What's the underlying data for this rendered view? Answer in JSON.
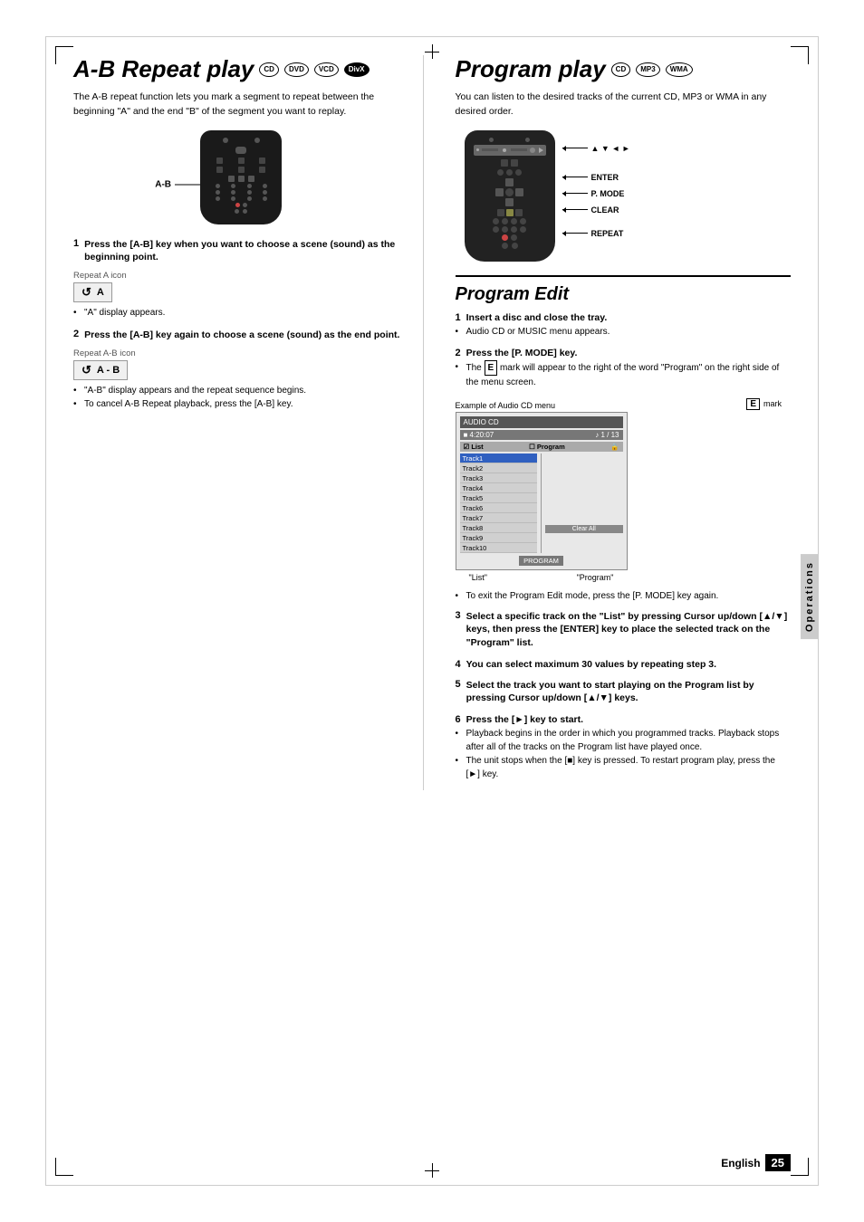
{
  "page": {
    "number": "25",
    "language": "English"
  },
  "ab_repeat": {
    "title": "A-B Repeat play",
    "formats": [
      "CD",
      "DVD",
      "VCD",
      "DivX"
    ],
    "intro": "The A-B repeat function lets you mark a segment to repeat between the beginning \"A\" and the end \"B\" of the segment you want to replay.",
    "ab_label": "A-B",
    "steps": [
      {
        "num": "1",
        "title": "Press the [A-B] key when you want to choose a scene (sound) as the beginning point.",
        "note_label": "Repeat A icon",
        "icon_text": "A",
        "bullets": [
          "\"A\" display appears."
        ]
      },
      {
        "num": "2",
        "title": "Press the [A-B] key again to choose a scene (sound) as the end point.",
        "note_label": "Repeat A-B icon",
        "icon_text": "A - B",
        "bullets": [
          "\"A-B\" display appears and the repeat sequence begins.",
          "To cancel A-B Repeat playback, press the [A-B] key."
        ]
      }
    ]
  },
  "program_play": {
    "title": "Program play",
    "formats": [
      "CD",
      "MP3",
      "WMA"
    ],
    "intro": "You can listen to the desired tracks of the current CD, MP3 or WMA in any desired order.",
    "labels": {
      "nav_arrows": "▲ ▼ ◄ ►",
      "enter": "ENTER",
      "p_mode": "P. MODE",
      "clear": "CLEAR",
      "repeat": "REPEAT"
    }
  },
  "program_edit": {
    "title": "Program Edit",
    "steps": [
      {
        "num": "1",
        "title": "Insert a disc and close the tray.",
        "bullets": [
          "Audio CD or MUSIC menu appears."
        ]
      },
      {
        "num": "2",
        "title": "Press the [P. MODE] key.",
        "bullets": [
          "The  E  mark will appear to the right of the word \"Program\" on the right side of the menu screen."
        ]
      },
      {
        "num": "2_sub",
        "example_label": "Example of Audio CD menu",
        "e_mark_label": "E  mark",
        "list_label": "\"List\"",
        "program_label": "\"Program\"",
        "cd_header": "AUDIO CD",
        "cd_subheader_left": "■  4:20:07",
        "cd_subheader_right": "♪ 1 / 13",
        "cd_col_list": "List",
        "cd_col_program": "Program",
        "tracks": [
          "Track1",
          "Track2",
          "Track3",
          "Track4",
          "Track5",
          "Track6",
          "Track7",
          "Track8",
          "Track9",
          "Track10"
        ],
        "clear_all": "Clear All",
        "footer_btn": "PROGRAM",
        "note": "To exit the Program Edit mode, press the [P. MODE] key again."
      },
      {
        "num": "3",
        "title": "Select a specific track on the \"List\" by pressing Cursor up/down [▲/▼] keys, then press the [ENTER] key to place the selected track on the \"Program\" list."
      },
      {
        "num": "4",
        "title": "You can select maximum 30 values by repeating step 3."
      },
      {
        "num": "5",
        "title": "Select the track you want to start playing on the Program list by pressing Cursor up/down [▲/▼] keys."
      },
      {
        "num": "6",
        "title": "Press the [►] key to start.",
        "bullets": [
          "Playback begins in the order in which you programmed tracks. Playback stops after all of the tracks on the Program list have played once.",
          "The unit stops when the [■] key is pressed. To restart program play, press the [►] key."
        ]
      }
    ]
  },
  "operations_tab": "Operations"
}
